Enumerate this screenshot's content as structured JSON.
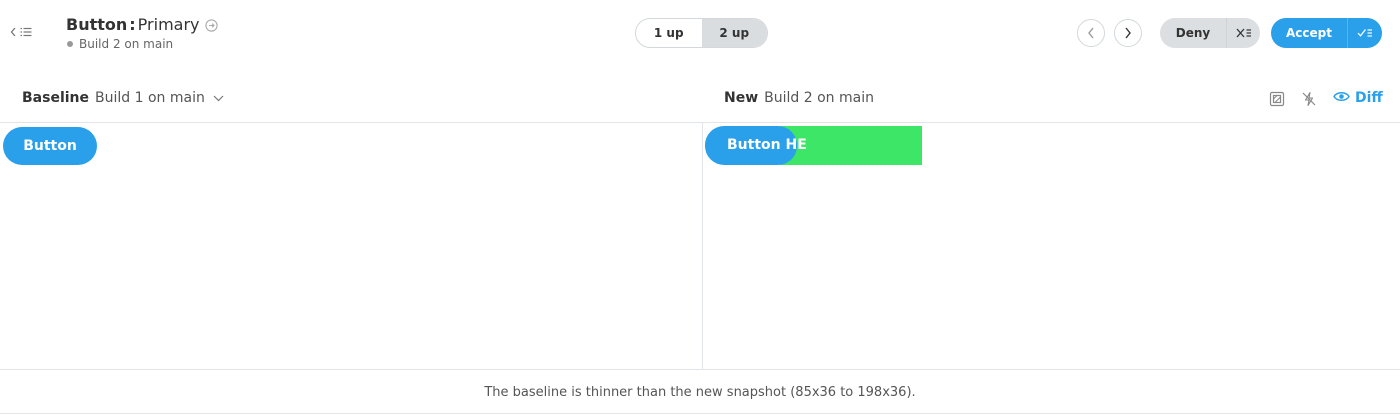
{
  "header": {
    "component_name": "Button",
    "separator": ":",
    "story_name": "Primary",
    "build_status": "Build 2 on main",
    "icons": {
      "back": "chevron-left-icon",
      "list": "list-icon",
      "story_link": "arrow-circle-right-icon"
    }
  },
  "view_toggle": {
    "options": [
      {
        "label": "1 up",
        "active": false
      },
      {
        "label": "2 up",
        "active": true
      }
    ]
  },
  "review": {
    "deny_label": "Deny",
    "accept_label": "Accept",
    "accept_color": "#2aa0ea"
  },
  "compare": {
    "baseline": {
      "label": "Baseline",
      "build": "Build 1 on main"
    },
    "new": {
      "label": "New",
      "build": "Build 2 on main"
    },
    "diff_label": "Diff",
    "diff_highlight_color": "#3ee667"
  },
  "snapshots": {
    "baseline_button_label": "Button",
    "new_button_label": "Button HE"
  },
  "footer": {
    "message": "The baseline is thinner than the new snapshot (85x36 to 198x36)."
  }
}
